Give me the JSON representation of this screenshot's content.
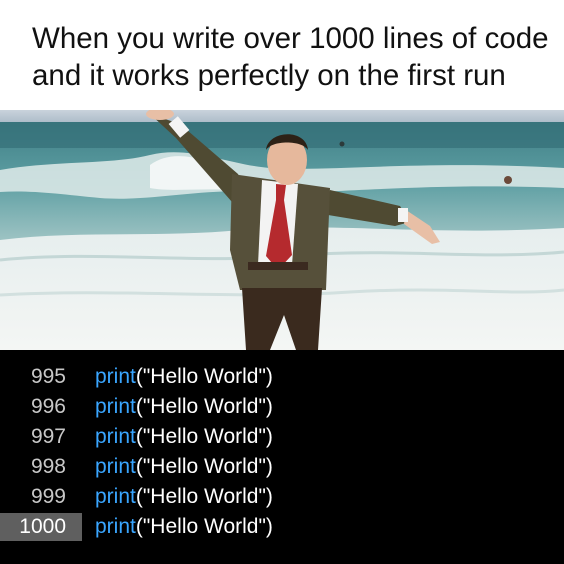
{
  "caption": {
    "line1": "When you write over 1000 lines of code",
    "line2": "and it works perfectly on the first run"
  },
  "photo": {
    "description_icon": "man-on-beach-arms-outstretched"
  },
  "code": {
    "lines": [
      {
        "num": "995",
        "fn": "print",
        "arg": "(\"Hello World\")"
      },
      {
        "num": "996",
        "fn": "print",
        "arg": "(\"Hello World\")"
      },
      {
        "num": "997",
        "fn": "print",
        "arg": "(\"Hello World\")"
      },
      {
        "num": "998",
        "fn": "print",
        "arg": "(\"Hello World\")"
      },
      {
        "num": "999",
        "fn": "print",
        "arg": "(\"Hello World\")"
      },
      {
        "num": "1000",
        "fn": "print",
        "arg": "(\"Hello World\")"
      }
    ],
    "active_line": "1000",
    "colors": {
      "background": "#000000",
      "function": "#3aa6ff",
      "text": "#ffffff",
      "active_gutter": "#5f5f5f"
    }
  }
}
